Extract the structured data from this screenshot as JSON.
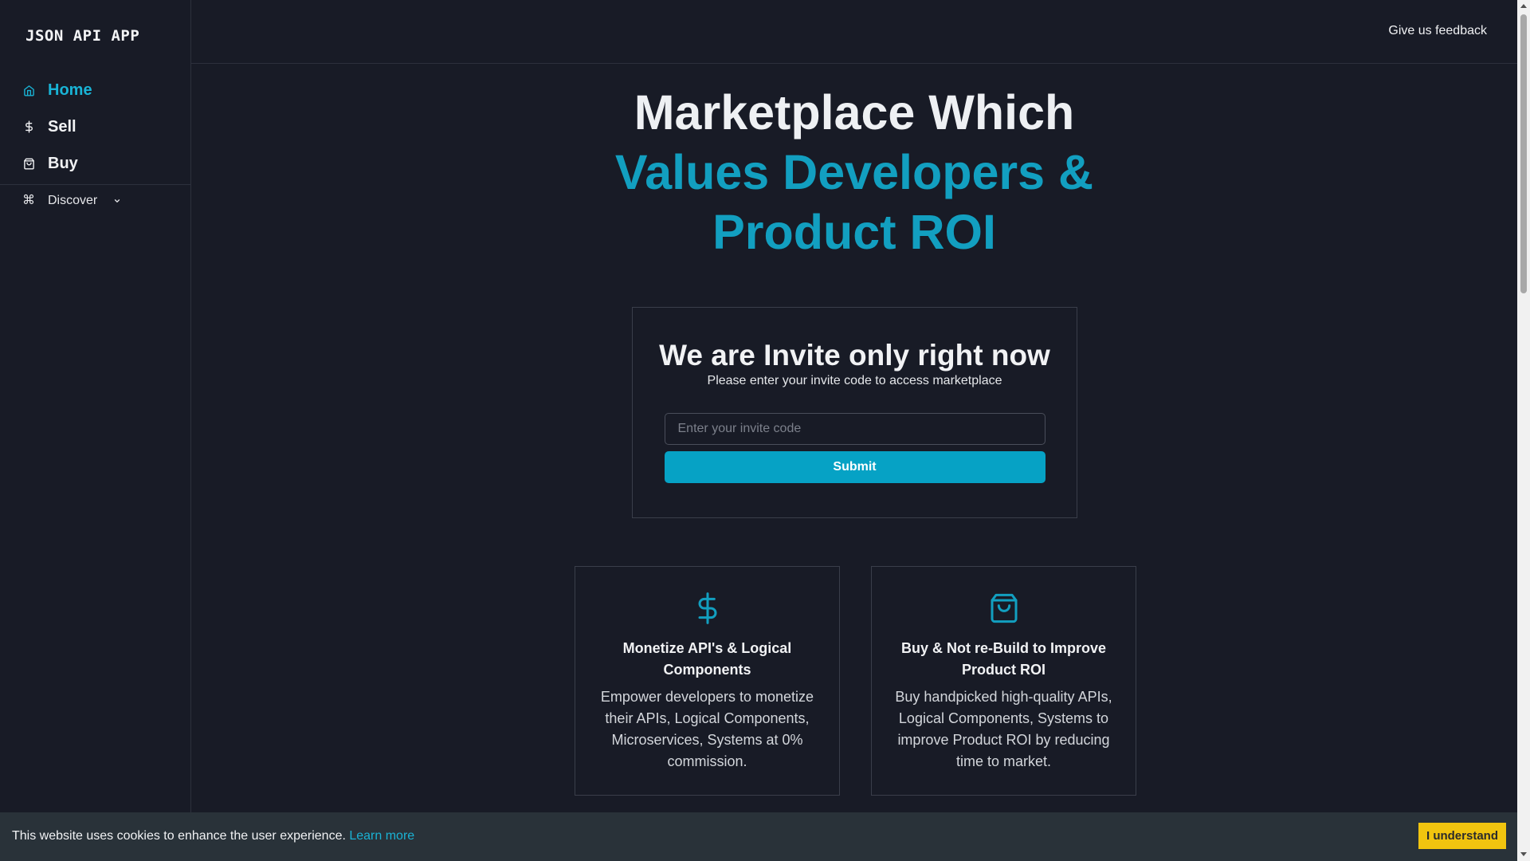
{
  "brand": "JSON API APP",
  "sidebar": {
    "items": [
      {
        "label": "Home",
        "icon": "home-icon",
        "active": true
      },
      {
        "label": "Sell",
        "icon": "dollar-icon"
      },
      {
        "label": "Buy",
        "icon": "shopping-bag-icon"
      }
    ],
    "discover": {
      "label": "Discover",
      "icon": "command-icon"
    }
  },
  "topbar": {
    "feedback_label": "Give us feedback"
  },
  "hero": {
    "line1": "Marketplace Which",
    "line2": "Values Developers & Product ROI"
  },
  "invite": {
    "title": "We are Invite only right now",
    "subtitle": "Please enter your invite code to access marketplace",
    "input_placeholder": "Enter your invite code",
    "input_value": "",
    "submit_label": "Submit"
  },
  "features": [
    {
      "icon": "dollar-icon",
      "title": "Monetize API's & Logical Components",
      "description": "Empower developers to monetize their APIs, Logical Components, Microservices, Systems at 0% commission."
    },
    {
      "icon": "shopping-bag-icon",
      "title": "Buy & Not re-Build to Improve Product ROI",
      "description": "Buy handpicked high-quality APIs, Logical Components, Systems to improve Product ROI by reducing time to market."
    }
  ],
  "cookie": {
    "text": "This website uses cookies to enhance the user experience.",
    "link_label": "Learn more",
    "button_label": "I understand"
  },
  "colors": {
    "background": "#181b26",
    "accent": "#129fc0",
    "button": "#06a2c5",
    "cookie_button": "#f1c40f"
  }
}
